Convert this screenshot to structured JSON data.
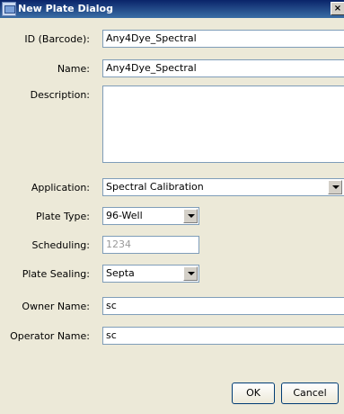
{
  "window": {
    "title": "New Plate Dialog",
    "close_glyph": "×"
  },
  "fields": {
    "id": {
      "label": "ID (Barcode):",
      "value": "Any4Dye_Spectral"
    },
    "name": {
      "label": "Name:",
      "value": "Any4Dye_Spectral"
    },
    "description": {
      "label": "Description:",
      "value": ""
    },
    "application": {
      "label": "Application:",
      "value": "Spectral Calibration"
    },
    "plate_type": {
      "label": "Plate Type:",
      "value": "96-Well"
    },
    "scheduling": {
      "label": "Scheduling:",
      "value": "1234"
    },
    "plate_sealing": {
      "label": "Plate Sealing:",
      "value": "Septa"
    },
    "owner_name": {
      "label": "Owner Name:",
      "value": "sc"
    },
    "operator_name": {
      "label": "Operator Name:",
      "value": "sc"
    }
  },
  "buttons": {
    "ok": "OK",
    "cancel": "Cancel"
  }
}
